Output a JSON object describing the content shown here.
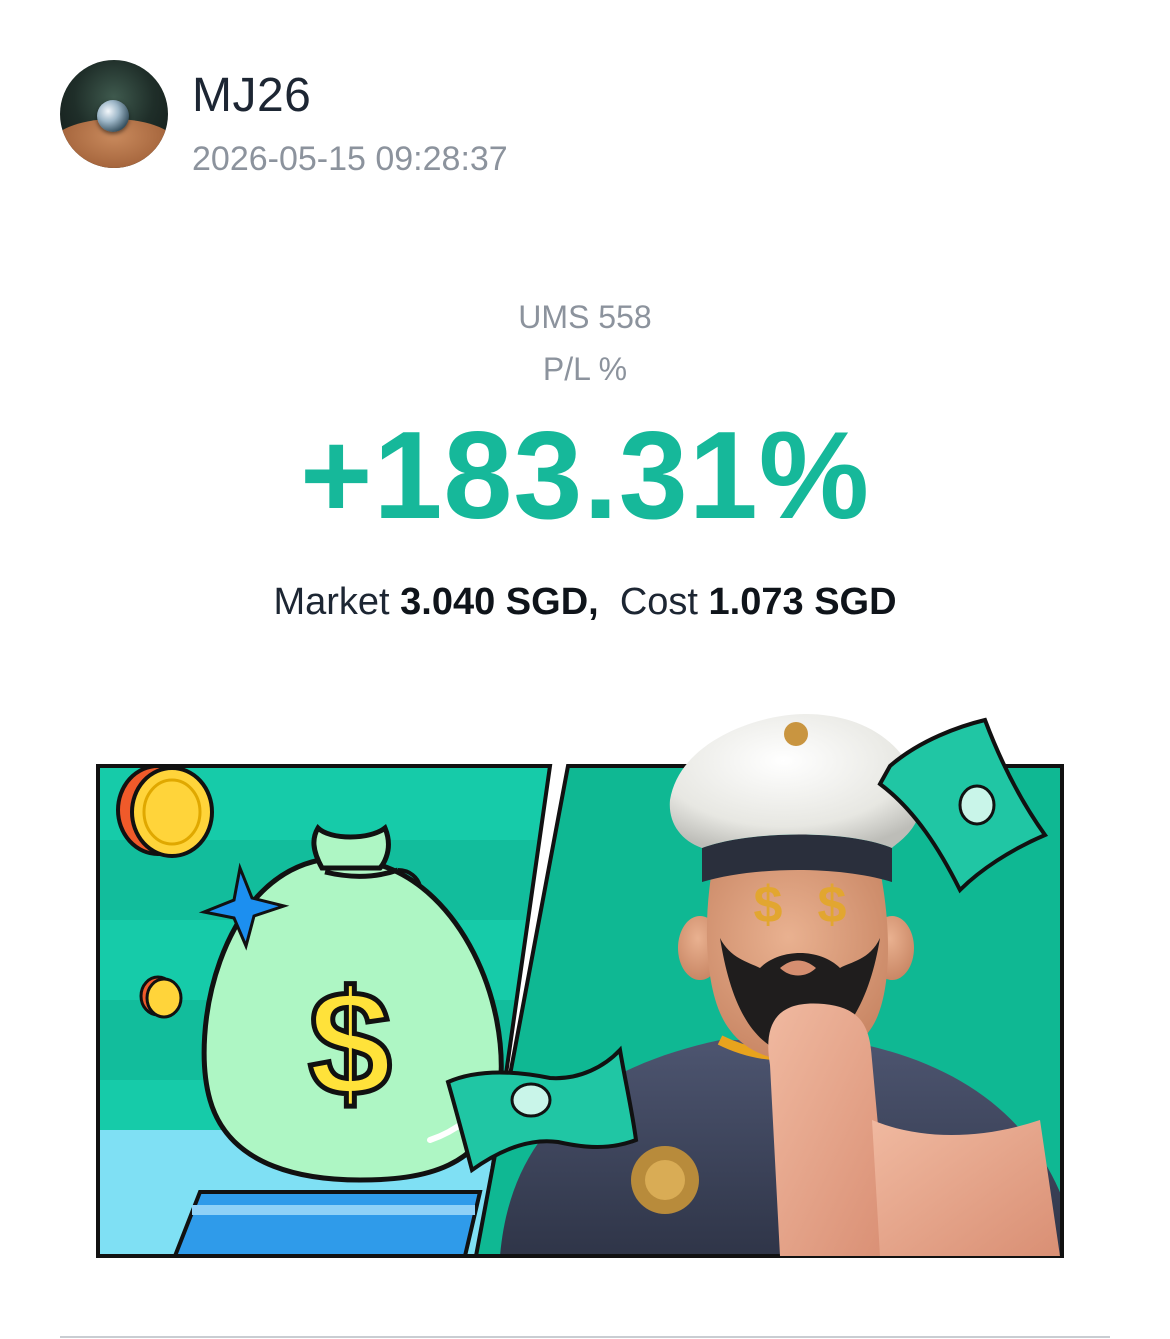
{
  "post": {
    "username": "MJ26",
    "timestamp": "2026-05-15 09:28:37"
  },
  "position": {
    "ticker": "UMS 558",
    "pl_label": "P/L %",
    "pl_value": "+183.31%",
    "market_label": "Market",
    "market_value": "3.040 SGD",
    "separator": ",",
    "cost_label": "Cost",
    "cost_value": "1.073 SGD"
  },
  "colors": {
    "profit": "#16b89a",
    "panel_green": "#12c9a8",
    "panel_dark_green": "#0fb893",
    "text_primary": "#1d2633",
    "text_muted": "#8c939d"
  },
  "icons": {
    "avatar": "avatar-image",
    "money_bag": "money-bag-icon",
    "dollar": "dollar-sign-icon",
    "coin": "coin-icon",
    "banknote": "banknote-icon",
    "sparkle": "sparkle-icon",
    "captain": "captain-character-image"
  }
}
